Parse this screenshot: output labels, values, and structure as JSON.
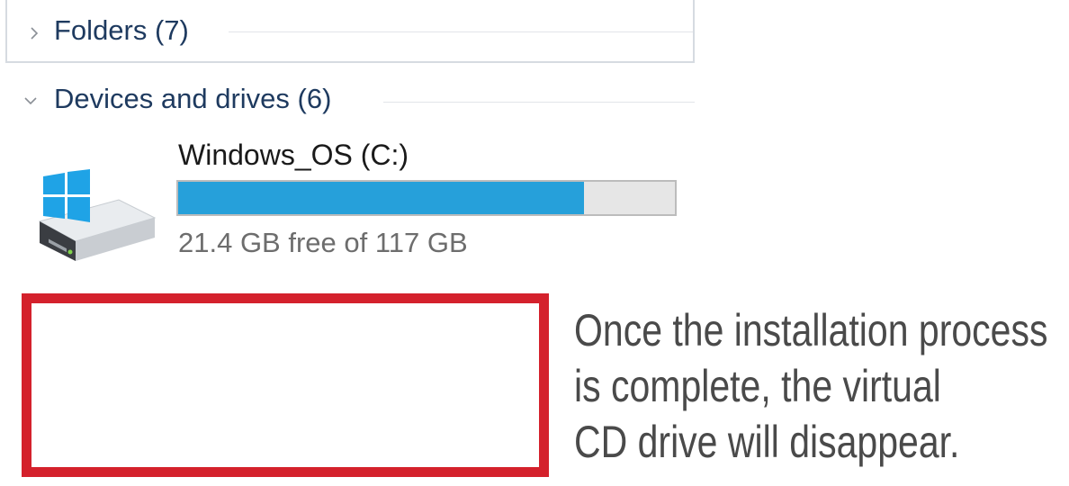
{
  "explorer": {
    "folders_section": {
      "label": "Folders (7)",
      "icon": "chevron-right-icon",
      "expanded": false
    },
    "devices_section": {
      "label": "Devices and drives (6)",
      "icon": "chevron-down-icon",
      "expanded": true
    },
    "drives": [
      {
        "name": "Windows_OS (C:)",
        "icon": "windows-drive-icon",
        "free_text": "21.4 GB free of 117 GB",
        "used_fraction": 0.817,
        "bar_color": "#26a0da"
      }
    ]
  },
  "annotation": {
    "highlight_color": "#d4212c",
    "caption_lines": [
      "Once the installation process",
      "is complete, the virtual",
      "CD drive will disappear."
    ]
  }
}
